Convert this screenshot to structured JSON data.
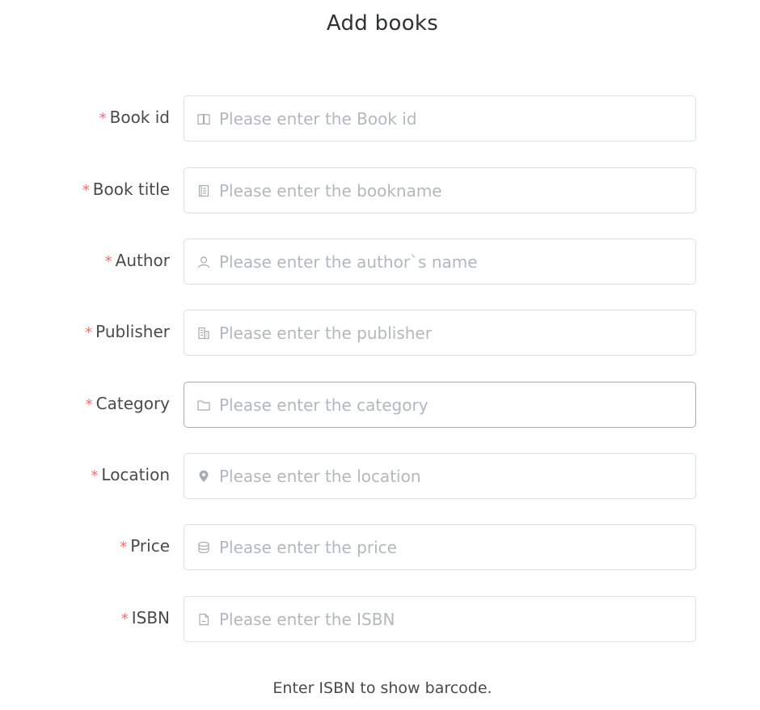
{
  "page": {
    "title": "Add books"
  },
  "colors": {
    "required_star": "#f56c6c",
    "placeholder": "#b4b7be",
    "border": "#dcdfe6",
    "icon": "#a8abb2"
  },
  "form": {
    "fields": [
      {
        "label": "Book id",
        "required_mark": "*",
        "placeholder": "Please enter the Book id",
        "value": "",
        "icon": "book-icon"
      },
      {
        "label": "Book title",
        "required_mark": "*",
        "placeholder": "Please enter the bookname",
        "value": "",
        "icon": "notebook-icon"
      },
      {
        "label": "Author",
        "required_mark": "*",
        "placeholder": "Please enter the author`s name",
        "value": "",
        "icon": "user-icon"
      },
      {
        "label": "Publisher",
        "required_mark": "*",
        "placeholder": "Please enter the publisher",
        "value": "",
        "icon": "office-building-icon"
      },
      {
        "label": "Category",
        "required_mark": "*",
        "placeholder": "Please enter the category",
        "value": "",
        "icon": "folder-icon"
      },
      {
        "label": "Location",
        "required_mark": "*",
        "placeholder": "Please enter the location",
        "value": "",
        "icon": "location-pin-icon"
      },
      {
        "label": "Price",
        "required_mark": "*",
        "placeholder": "Please enter the price",
        "value": "",
        "icon": "coin-icon"
      },
      {
        "label": "ISBN",
        "required_mark": "*",
        "placeholder": "Please enter the ISBN",
        "value": "",
        "icon": "document-icon"
      }
    ]
  },
  "barcode": {
    "hint": "Enter ISBN to show barcode."
  }
}
